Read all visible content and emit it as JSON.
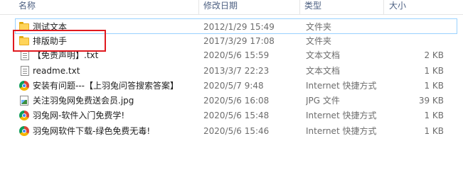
{
  "columns": {
    "name": "名称",
    "modified": "修改日期",
    "type": "类型",
    "size": "大小"
  },
  "files": [
    {
      "name": "测试文本",
      "modified": "2012/1/29 15:49",
      "type": "文件夹",
      "size": "",
      "icon": "folder-icon"
    },
    {
      "name": "排版助手",
      "modified": "2017/3/29 17:08",
      "type": "文件夹",
      "size": "",
      "icon": "folder-icon"
    },
    {
      "name": "【免责声明】.txt",
      "modified": "2020/5/6 15:59",
      "type": "文本文档",
      "size": "2 KB",
      "icon": "text-file-icon"
    },
    {
      "name": "readme.txt",
      "modified": "2013/3/7 22:23",
      "type": "文本文档",
      "size": "1 KB",
      "icon": "text-file-icon"
    },
    {
      "name": "安装有问题---【上羽兔问答搜索答案】",
      "modified": "2020/5/7 9:48",
      "type": "Internet 快捷方式",
      "size": "1 KB",
      "icon": "internet-shortcut-icon"
    },
    {
      "name": "关注羽兔网免费送会员.jpg",
      "modified": "2020/5/6 16:08",
      "type": "JPG 文件",
      "size": "39 KB",
      "icon": "image-file-icon"
    },
    {
      "name": "羽兔网-软件入门免费学!",
      "modified": "2020/5/6 15:48",
      "type": "Internet 快捷方式",
      "size": "1 KB",
      "icon": "internet-shortcut-icon"
    },
    {
      "name": "羽兔网软件下载-绿色免费无毒!",
      "modified": "2020/5/6 15:46",
      "type": "Internet 快捷方式",
      "size": "1 KB",
      "icon": "internet-shortcut-icon"
    }
  ],
  "colors": {
    "highlight": "#e0191f",
    "focus": "#99d1ff",
    "header_text": "#4d6082"
  }
}
